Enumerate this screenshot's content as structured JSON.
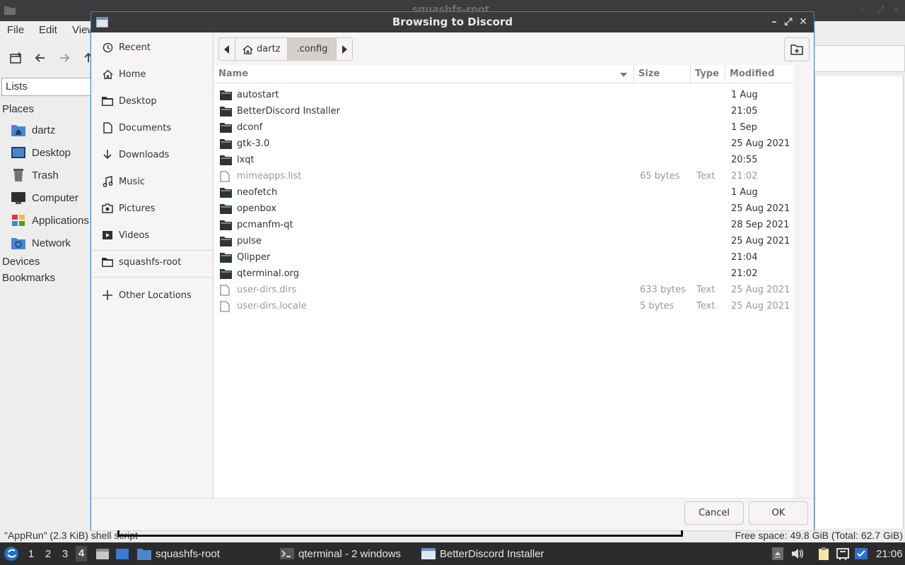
{
  "background_window": {
    "title": "squashfs-root",
    "menu": [
      "File",
      "Edit",
      "View"
    ],
    "view_mode": "Lists",
    "places_header": "Places",
    "places": [
      {
        "label": "dartz",
        "icon": "home-folder-icon"
      },
      {
        "label": "Desktop",
        "icon": "desktop-icon"
      },
      {
        "label": "Trash",
        "icon": "trash-icon"
      },
      {
        "label": "Computer",
        "icon": "computer-icon"
      },
      {
        "label": "Applications",
        "icon": "applications-icon"
      },
      {
        "label": "Network",
        "icon": "network-icon"
      }
    ],
    "devices_header": "Devices",
    "bookmarks_header": "Bookmarks",
    "status_left": "\"AppRun\" (2.3 KiB) shell script",
    "status_right": "Free space: 49.8 GiB (Total: 62.7 GiB)"
  },
  "dialog": {
    "title": "Browsing to Discord",
    "places": [
      {
        "label": "Recent",
        "icon": "recent-icon"
      },
      {
        "label": "Home",
        "icon": "home-icon"
      },
      {
        "label": "Desktop",
        "icon": "folder-icon"
      },
      {
        "label": "Documents",
        "icon": "document-icon"
      },
      {
        "label": "Downloads",
        "icon": "download-icon"
      },
      {
        "label": "Music",
        "icon": "music-icon"
      },
      {
        "label": "Pictures",
        "icon": "camera-icon"
      },
      {
        "label": "Videos",
        "icon": "video-icon"
      },
      {
        "label": "squashfs-root",
        "icon": "folder-icon"
      },
      {
        "label": "Other Locations",
        "icon": "plus-icon"
      }
    ],
    "path": [
      "dartz",
      ".config"
    ],
    "columns": {
      "name": "Name",
      "size": "Size",
      "type": "Type",
      "modified": "Modified"
    },
    "files": [
      {
        "name": "autostart",
        "size": "",
        "type": "",
        "modified": "1 Aug",
        "kind": "folder"
      },
      {
        "name": "BetterDiscord Installer",
        "size": "",
        "type": "",
        "modified": "21:05",
        "kind": "folder"
      },
      {
        "name": "dconf",
        "size": "",
        "type": "",
        "modified": "1 Sep",
        "kind": "folder"
      },
      {
        "name": "gtk-3.0",
        "size": "",
        "type": "",
        "modified": "25 Aug 2021",
        "kind": "folder"
      },
      {
        "name": "lxqt",
        "size": "",
        "type": "",
        "modified": "20:55",
        "kind": "folder"
      },
      {
        "name": "mimeapps.list",
        "size": "65 bytes",
        "type": "Text",
        "modified": "21:02",
        "kind": "file"
      },
      {
        "name": "neofetch",
        "size": "",
        "type": "",
        "modified": "1 Aug",
        "kind": "folder"
      },
      {
        "name": "openbox",
        "size": "",
        "type": "",
        "modified": "25 Aug 2021",
        "kind": "folder"
      },
      {
        "name": "pcmanfm-qt",
        "size": "",
        "type": "",
        "modified": "28 Sep 2021",
        "kind": "folder"
      },
      {
        "name": "pulse",
        "size": "",
        "type": "",
        "modified": "25 Aug 2021",
        "kind": "folder"
      },
      {
        "name": "Qlipper",
        "size": "",
        "type": "",
        "modified": "21:04",
        "kind": "folder"
      },
      {
        "name": "qterminal.org",
        "size": "",
        "type": "",
        "modified": "21:02",
        "kind": "folder"
      },
      {
        "name": "user-dirs.dirs",
        "size": "633 bytes",
        "type": "Text",
        "modified": "25 Aug 2021",
        "kind": "file"
      },
      {
        "name": "user-dirs.locale",
        "size": "5 bytes",
        "type": "Text",
        "modified": "25 Aug 2021",
        "kind": "file"
      }
    ],
    "cancel_label": "Cancel",
    "ok_label": "OK"
  },
  "taskbar": {
    "workspaces": [
      "1",
      "2",
      "3",
      "4"
    ],
    "active_workspace": "4",
    "tasks": [
      {
        "label": "squashfs-root",
        "icon": "folder-icon"
      },
      {
        "label": "qterminal - 2 windows",
        "icon": "terminal-icon"
      },
      {
        "label": "BetterDiscord Installer",
        "icon": "window-icon"
      }
    ],
    "clock": "21:06"
  }
}
